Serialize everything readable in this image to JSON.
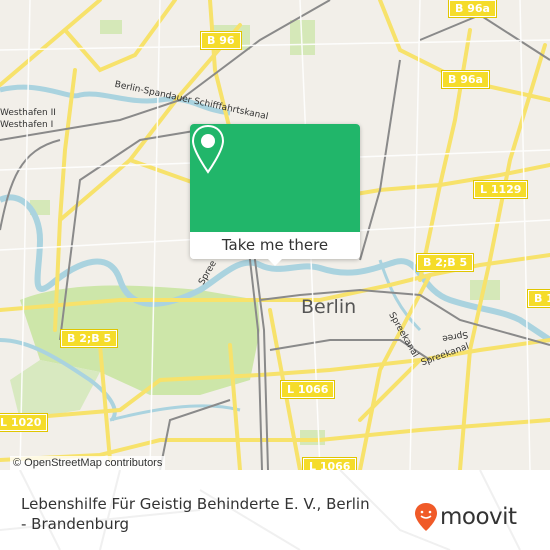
{
  "map": {
    "city_label": "Berlin",
    "attribution": "© OpenStreetMap contributors",
    "road_shields": [
      "B 96",
      "B 96a",
      "B 96a",
      "L 1129",
      "B 2;B 5",
      "B 2;B 5",
      "B 1",
      "L 1066",
      "L 1066",
      "L 1020"
    ],
    "water_labels": [
      "Berlin-Spandauer Schifffahrtskanal",
      "Spree",
      "Spree",
      "Spreekanal",
      "Spreekanal",
      "Westhafen II",
      "Westhafen I"
    ],
    "colors": {
      "land": "#f2efe9",
      "park": "#cde6a9",
      "water": "#aad3df",
      "major_road": "#f7e26b",
      "rail": "#8a8a8a",
      "accent": "#21b66a"
    }
  },
  "popup": {
    "icon": "map-pin-icon",
    "button_label": "Take me there"
  },
  "footer": {
    "place_title": "Lebenshilfe Für Geistig Behinderte E. V., Berlin - Brandenburg",
    "brand_name": "moovit",
    "brand_icon": "moovit-smiley-pin-icon",
    "brand_color": "#f05a28"
  }
}
